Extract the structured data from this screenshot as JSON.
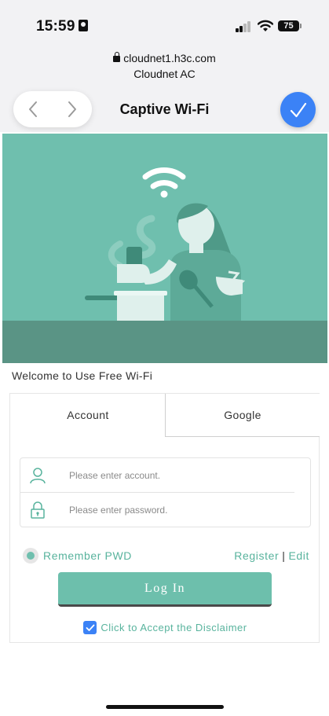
{
  "status_bar": {
    "time": "15:59",
    "battery": "75"
  },
  "browser": {
    "url": "cloudnet1.h3c.com",
    "site_name": "Cloudnet AC",
    "title": "Captive Wi-Fi",
    "back_icon": "chevron-left-icon",
    "forward_icon": "chevron-right-icon",
    "done_icon": "checkmark-icon"
  },
  "hero": {
    "colors": {
      "background": "#6fbfae",
      "counter": "#5a9485",
      "figure": "#5daa98",
      "light": "#dff0ec"
    }
  },
  "portal": {
    "welcome": "Welcome to Use Free Wi-Fi",
    "tabs": [
      {
        "label": "Account",
        "selected": true
      },
      {
        "label": "Google",
        "selected": false
      }
    ],
    "account_placeholder": "Please enter account.",
    "password_placeholder": "Please enter password.",
    "remember_label": "Remember PWD",
    "register_label": "Register",
    "link_separator": "|",
    "edit_label": "Edit",
    "login_label": "Log In",
    "disclaimer_label": "Click to Accept the Disclaimer",
    "accent_color": "#58b39d"
  }
}
